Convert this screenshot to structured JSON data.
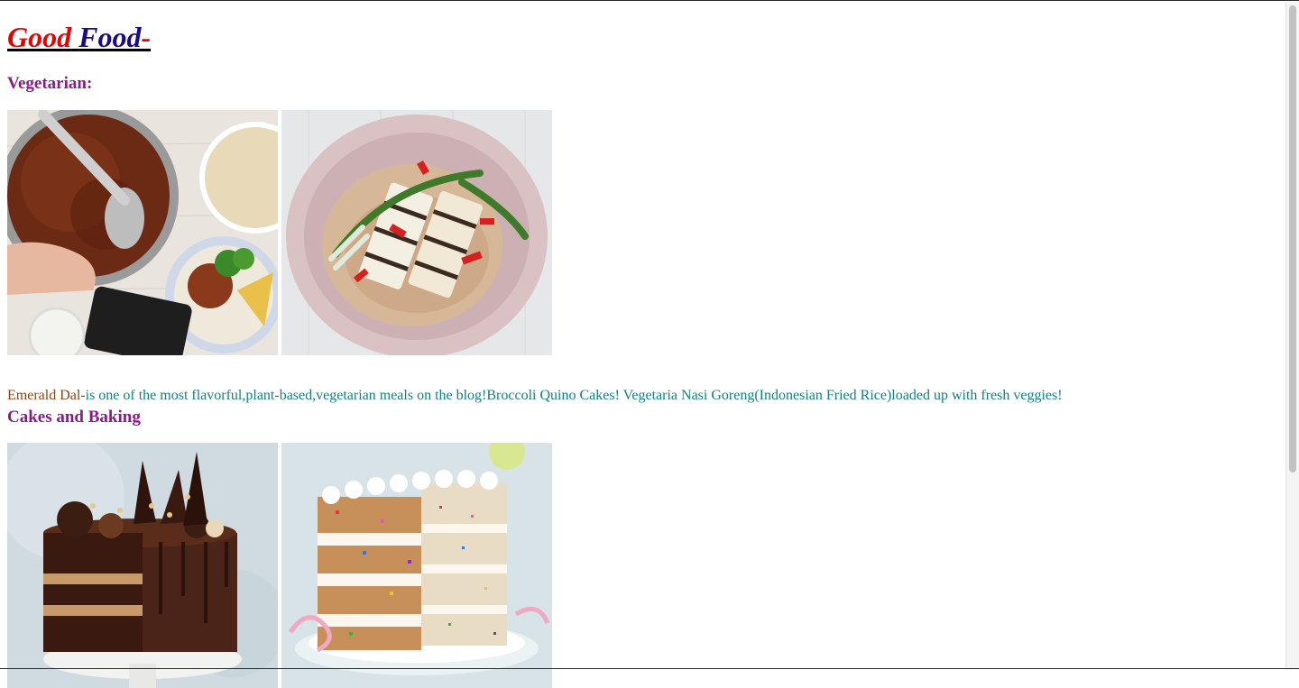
{
  "header": {
    "logo_word1": "Good",
    "logo_word2": "Food",
    "logo_dash": "-"
  },
  "vegetarian": {
    "heading": "Vegetarian:",
    "images": [
      "chili-pot-with-rice-photo",
      "grilled-tofu-rice-bowl-photo"
    ],
    "description_name": "Emerald Dal-",
    "description_text": "is one of the most flavorful,plant-based,vegetarian meals on the blog!Broccoli Quino Cakes! Vegetaria Nasi Goreng(Indonesian Fried Rice)loaded up with fresh veggies!"
  },
  "cakes": {
    "heading": "Cakes and Baking",
    "images": [
      "chocolate-layer-cake-photo",
      "funfetti-sprinkle-cake-photo"
    ]
  },
  "colors": {
    "logo_red": "#ee0000",
    "logo_blue": "#1a0a8c",
    "heading_purple": "#8b1a8b",
    "text_teal": "#138080",
    "name_brown": "#8b4513"
  }
}
